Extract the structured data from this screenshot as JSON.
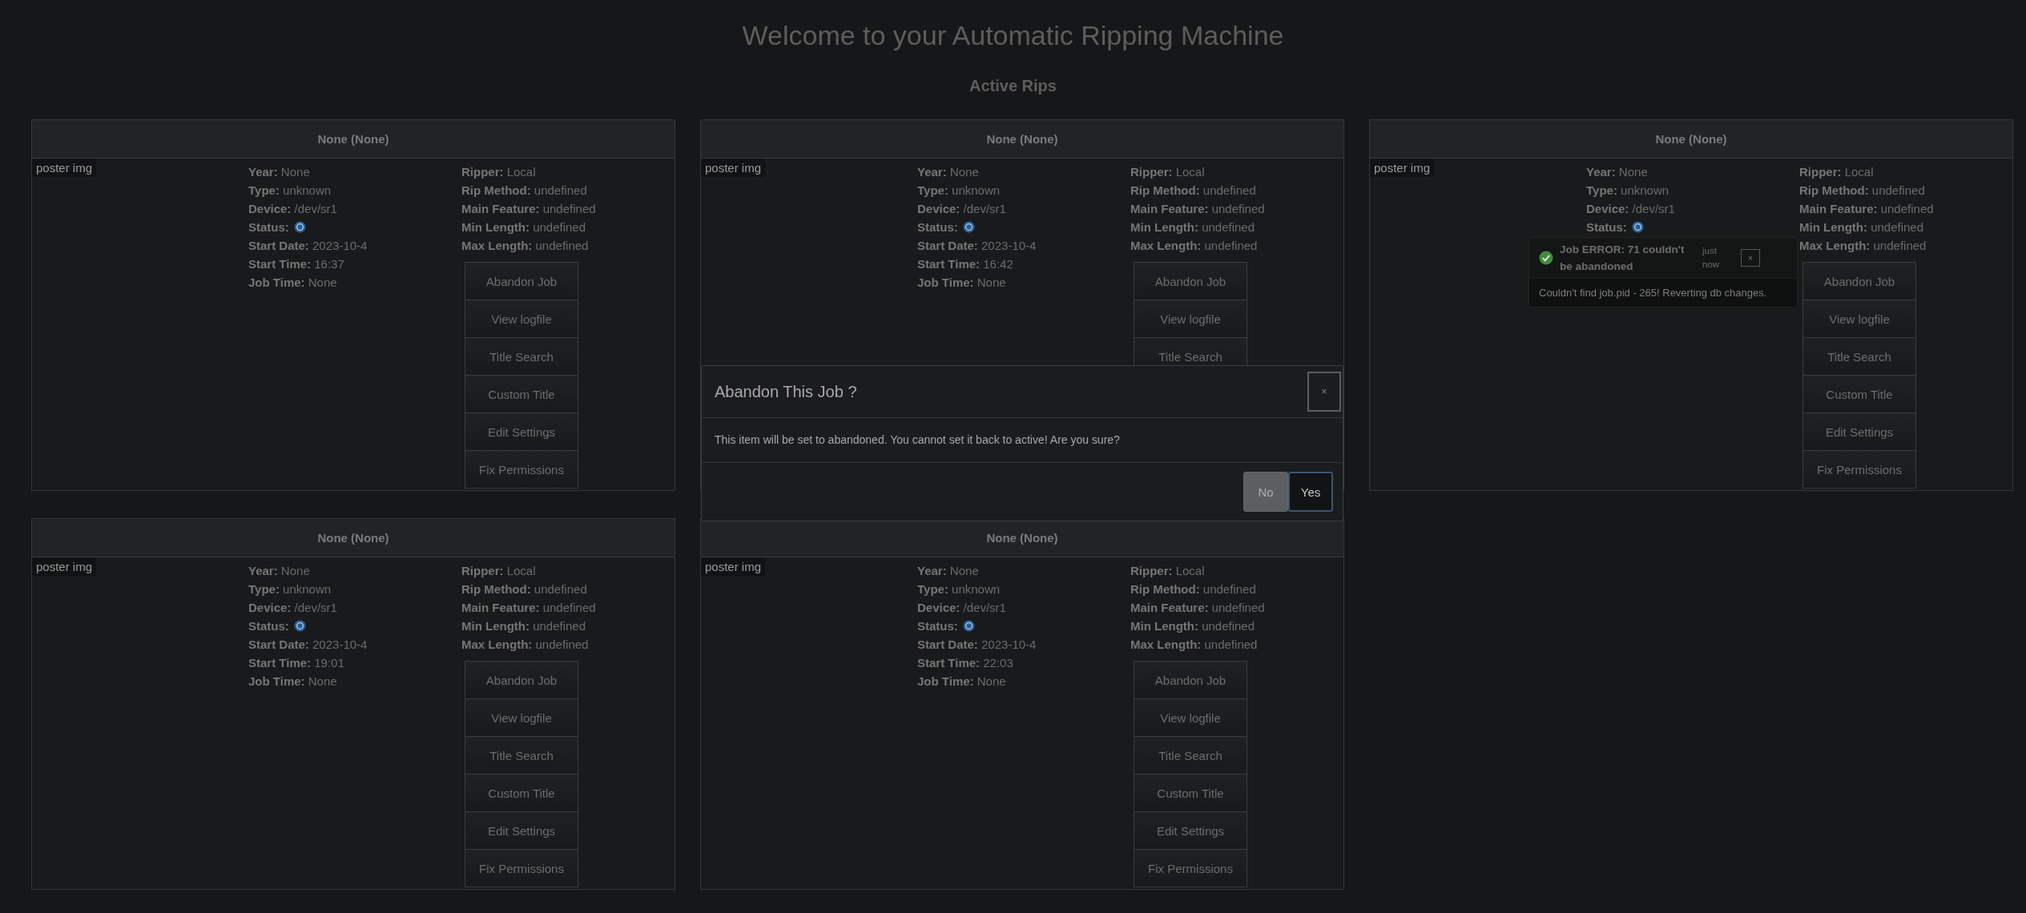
{
  "page": {
    "title": "Welcome to your Automatic Ripping Machine",
    "subtitle": "Active Rips"
  },
  "jobs": [
    {
      "title": "None (None)",
      "poster": "poster img",
      "details_left": [
        {
          "kind": "text",
          "label": "Year:",
          "value": "None"
        },
        {
          "kind": "text",
          "label": "Type:",
          "value": "unknown"
        },
        {
          "kind": "text",
          "label": "Device:",
          "value": "/dev/sr1"
        },
        {
          "kind": "status",
          "label": "Status:"
        },
        {
          "kind": "text",
          "label": "Start Date:",
          "value": "2023-10-4"
        },
        {
          "kind": "text",
          "label": "Start Time:",
          "value": "16:37"
        },
        {
          "kind": "text",
          "label": "Job Time:",
          "value": "None"
        }
      ],
      "details_right": [
        {
          "label": "Ripper:",
          "value": "Local"
        },
        {
          "label": "Rip Method:",
          "value": "undefined"
        },
        {
          "label": "Main Feature:",
          "value": "undefined"
        },
        {
          "label": "Min Length:",
          "value": "undefined"
        },
        {
          "label": "Max Length:",
          "value": "undefined"
        }
      ],
      "buttons": [
        "Abandon Job",
        "View logfile",
        "Title Search",
        "Custom Title",
        "Edit Settings",
        "Fix Permissions"
      ]
    },
    {
      "title": "None (None)",
      "poster": "poster img",
      "details_left": [
        {
          "kind": "text",
          "label": "Year:",
          "value": "None"
        },
        {
          "kind": "text",
          "label": "Type:",
          "value": "unknown"
        },
        {
          "kind": "text",
          "label": "Device:",
          "value": "/dev/sr1"
        },
        {
          "kind": "status",
          "label": "Status:"
        },
        {
          "kind": "text",
          "label": "Start Date:",
          "value": "2023-10-4"
        },
        {
          "kind": "text",
          "label": "Start Time:",
          "value": "16:42"
        },
        {
          "kind": "text",
          "label": "Job Time:",
          "value": "None"
        }
      ],
      "details_right": [
        {
          "label": "Ripper:",
          "value": "Local"
        },
        {
          "label": "Rip Method:",
          "value": "undefined"
        },
        {
          "label": "Main Feature:",
          "value": "undefined"
        },
        {
          "label": "Min Length:",
          "value": "undefined"
        },
        {
          "label": "Max Length:",
          "value": "undefined"
        }
      ],
      "buttons": [
        "Abandon Job",
        "View logfile",
        "Title Search"
      ]
    },
    {
      "title": "None (None)",
      "poster": "poster img",
      "details_left": [
        {
          "kind": "text",
          "label": "Year:",
          "value": "None"
        },
        {
          "kind": "text",
          "label": "Type:",
          "value": "unknown"
        },
        {
          "kind": "text",
          "label": "Device:",
          "value": "/dev/sr1"
        },
        {
          "kind": "status",
          "label": "Status:"
        }
      ],
      "details_right": [
        {
          "label": "Ripper:",
          "value": "Local"
        },
        {
          "label": "Rip Method:",
          "value": "undefined"
        },
        {
          "label": "Main Feature:",
          "value": "undefined"
        },
        {
          "label": "Min Length:",
          "value": "undefined"
        },
        {
          "label": "Max Length:",
          "value": "undefined"
        }
      ],
      "buttons": [
        "Abandon Job",
        "View logfile",
        "Title Search",
        "Custom Title",
        "Edit Settings",
        "Fix Permissions"
      ]
    },
    {
      "title": "None (None)",
      "poster": "poster img",
      "details_left": [
        {
          "kind": "text",
          "label": "Year:",
          "value": "None"
        },
        {
          "kind": "text",
          "label": "Type:",
          "value": "unknown"
        },
        {
          "kind": "text",
          "label": "Device:",
          "value": "/dev/sr1"
        },
        {
          "kind": "status",
          "label": "Status:"
        },
        {
          "kind": "text",
          "label": "Start Date:",
          "value": "2023-10-4"
        },
        {
          "kind": "text",
          "label": "Start Time:",
          "value": "19:01"
        },
        {
          "kind": "text",
          "label": "Job Time:",
          "value": "None"
        }
      ],
      "details_right": [
        {
          "label": "Ripper:",
          "value": "Local"
        },
        {
          "label": "Rip Method:",
          "value": "undefined"
        },
        {
          "label": "Main Feature:",
          "value": "undefined"
        },
        {
          "label": "Min Length:",
          "value": "undefined"
        },
        {
          "label": "Max Length:",
          "value": "undefined"
        }
      ],
      "buttons": [
        "Abandon Job",
        "View logfile",
        "Title Search",
        "Custom Title",
        "Edit Settings",
        "Fix Permissions"
      ]
    },
    {
      "title": "None (None)",
      "poster": "poster img",
      "details_left": [
        {
          "kind": "text",
          "label": "Year:",
          "value": "None"
        },
        {
          "kind": "text",
          "label": "Type:",
          "value": "unknown"
        },
        {
          "kind": "text",
          "label": "Device:",
          "value": "/dev/sr1"
        },
        {
          "kind": "status",
          "label": "Status:"
        },
        {
          "kind": "text",
          "label": "Start Date:",
          "value": "2023-10-4"
        },
        {
          "kind": "text",
          "label": "Start Time:",
          "value": "22:03"
        },
        {
          "kind": "text",
          "label": "Job Time:",
          "value": "None"
        }
      ],
      "details_right": [
        {
          "label": "Ripper:",
          "value": "Local"
        },
        {
          "label": "Rip Method:",
          "value": "undefined"
        },
        {
          "label": "Main Feature:",
          "value": "undefined"
        },
        {
          "label": "Min Length:",
          "value": "undefined"
        },
        {
          "label": "Max Length:",
          "value": "undefined"
        }
      ],
      "buttons": [
        "Abandon Job",
        "View logfile",
        "Title Search",
        "Custom Title",
        "Edit Settings",
        "Fix Permissions"
      ]
    }
  ],
  "modal": {
    "title": "Abandon This Job ?",
    "close": "×",
    "message": "This item will be set to abandoned. You cannot set it back to active! Are you sure?",
    "buttons": [
      {
        "label": "No",
        "kind": "secondary"
      },
      {
        "label": "Yes",
        "kind": "primary"
      }
    ]
  },
  "toast": {
    "title": "Job ERROR: 71 couldn't be abandoned",
    "time": "just now",
    "close": "×",
    "message": "Couldn't find job.pid - 265! Reverting db changes."
  }
}
